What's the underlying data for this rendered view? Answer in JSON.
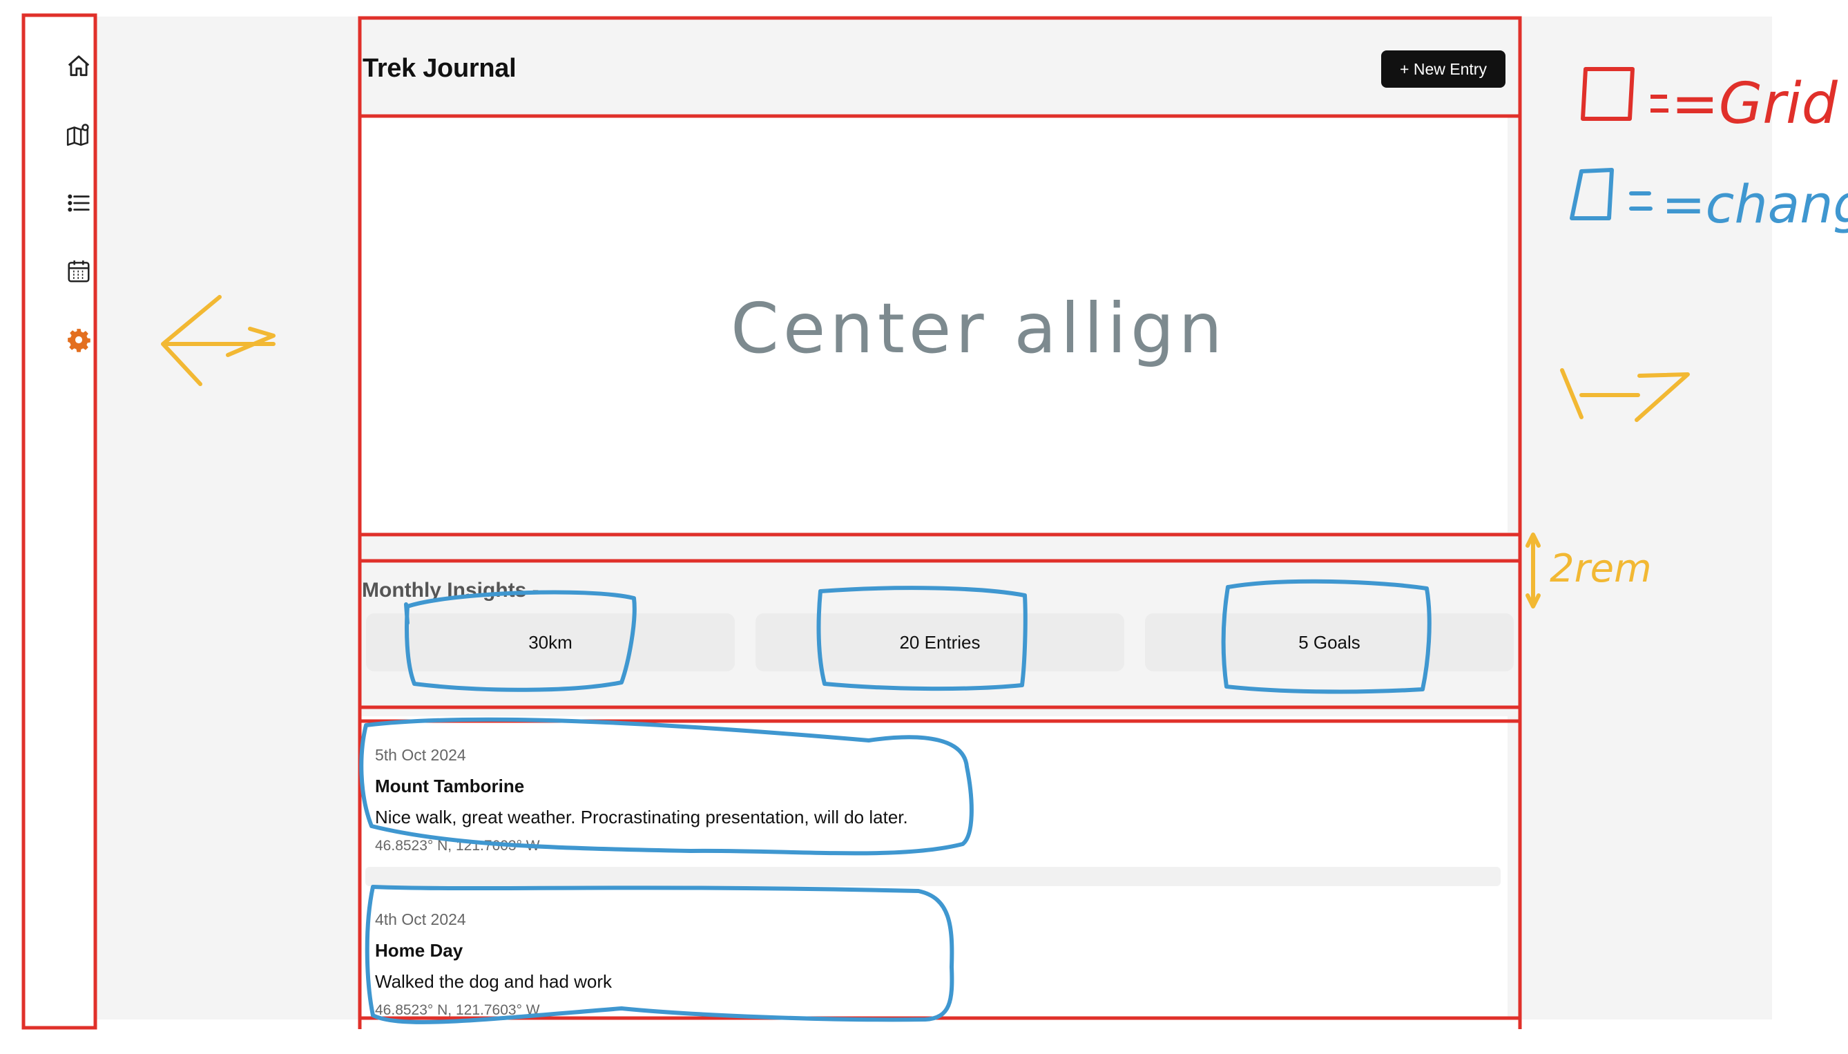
{
  "app": {
    "title": "Trek Journal",
    "new_entry_label": "+ New Entry"
  },
  "sidebar": {
    "items": [
      {
        "icon": "home-icon"
      },
      {
        "icon": "map-icon"
      },
      {
        "icon": "list-icon"
      },
      {
        "icon": "calendar-icon"
      },
      {
        "icon": "gear-icon",
        "color": "#e36f1f"
      }
    ]
  },
  "hero": {
    "note": "Center allign"
  },
  "insights": {
    "title": "Monthly Insights -",
    "stats": [
      "30km",
      "20 Entries",
      "5 Goals"
    ]
  },
  "entries": [
    {
      "date": "5th Oct 2024",
      "title": "Mount Tamborine",
      "body": "Nice walk, great weather. Procrastinating presentation, will do later.",
      "coords": "46.8523° N, 121.7603° W"
    },
    {
      "date": "4th Oct 2024",
      "title": "Home Day",
      "body": "Walked the dog and had work",
      "coords": "46.8523° N, 121.7603° W"
    }
  ],
  "legend": {
    "grid_label": "=Grid",
    "change_label": "=change",
    "spacing_label": "2rem"
  },
  "colors": {
    "grid": "#e0302a",
    "change": "#3f97d0",
    "arrows": "#f2b833",
    "handwriting": "#7d8a8f"
  }
}
